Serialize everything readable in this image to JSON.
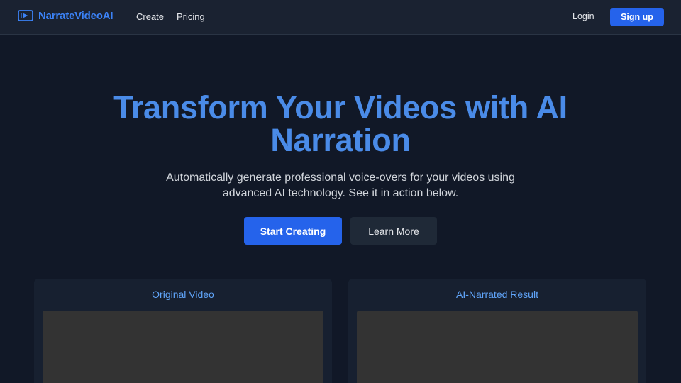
{
  "brand": {
    "name": "NarrateVideoAI",
    "icon": "video-icon",
    "color": "#3b82f6"
  },
  "nav": {
    "create_label": "Create",
    "pricing_label": "Pricing"
  },
  "auth": {
    "login_label": "Login",
    "signup_label": "Sign up"
  },
  "hero": {
    "title_line1": "Transform Your Videos with AI",
    "title_line2": "Narration",
    "subtitle_line1": "Automatically generate professional voice-overs for your videos using",
    "subtitle_line2": "advanced AI technology. See it in action below.",
    "primary_button": "Start Creating",
    "secondary_button": "Learn More"
  },
  "comparison": {
    "left_title": "Original Video",
    "right_title": "AI-Narrated Result"
  },
  "colors": {
    "background": "#111827",
    "accent": "#2563eb",
    "title": "#4a8be8"
  }
}
